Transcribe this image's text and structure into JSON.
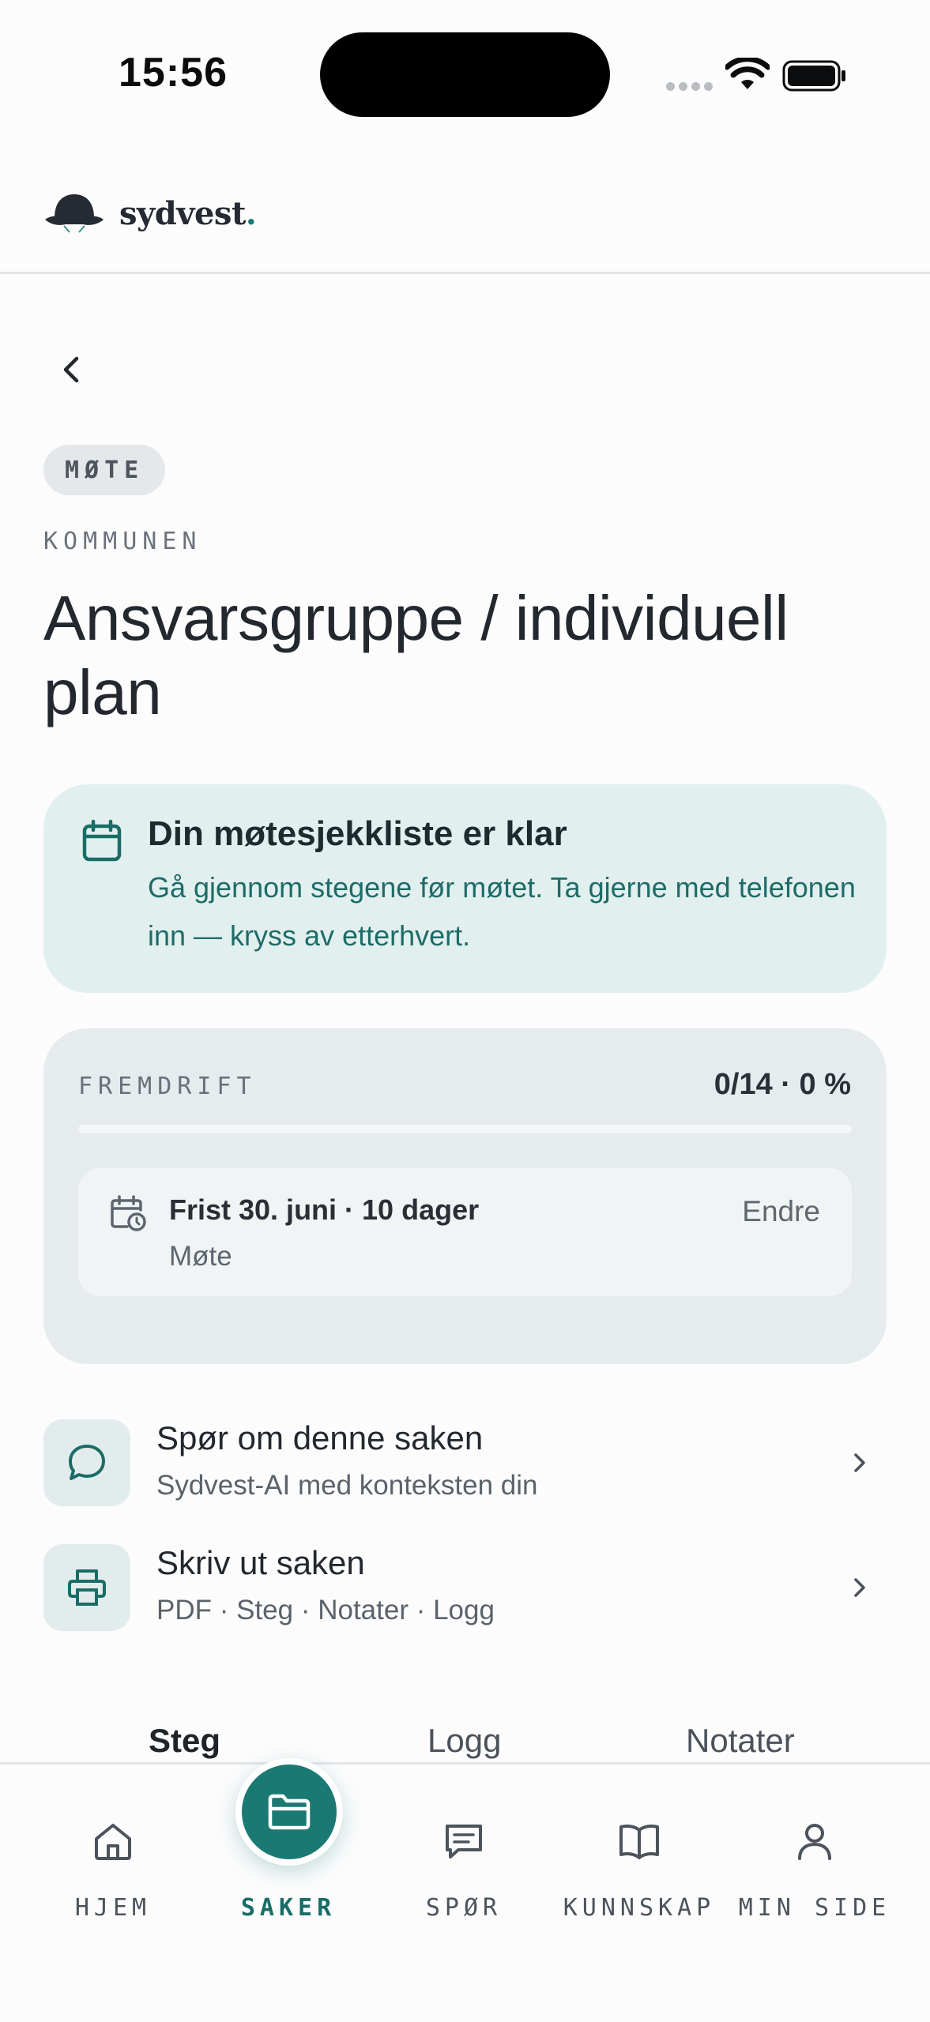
{
  "status_bar": {
    "time": "15:56"
  },
  "header": {
    "brand": "sydvest",
    "brand_dot": "."
  },
  "nav": {
    "back_icon": "chevron-left-icon"
  },
  "case": {
    "tag": "MØTE",
    "category": "KOMMUNEN",
    "title": "Ansvarsgruppe / individuell plan"
  },
  "info_card": {
    "icon": "calendar-icon",
    "title": "Din møtesjekkliste er klar",
    "body": "Gå gjennom stegene før møtet. Ta gjerne med telefonen inn — kryss av etterhvert."
  },
  "progress": {
    "label": "FREMDRIFT",
    "value_text": "0/14 · 0 %",
    "completed": 0,
    "total": 14,
    "percent": 0,
    "deadline": {
      "icon": "calendar-clock-icon",
      "title": "Frist 30. juni · 10 dager",
      "subtitle": "Møte",
      "edit_label": "Endre"
    }
  },
  "actions": [
    {
      "icon": "chat-bubble-icon",
      "title": "Spør om denne saken",
      "subtitle": "Sydvest-AI med konteksten din"
    },
    {
      "icon": "printer-icon",
      "title": "Skriv ut saken",
      "subtitle": "PDF · Steg · Notater · Logg"
    }
  ],
  "tabs": [
    {
      "label": "Steg",
      "active": true
    },
    {
      "label": "Logg",
      "active": false
    },
    {
      "label": "Notater",
      "active": false
    }
  ],
  "bottom_nav": [
    {
      "label": "HJEM",
      "icon": "home-icon",
      "active": false
    },
    {
      "label": "SAKER",
      "icon": "folder-icon",
      "active": true
    },
    {
      "label": "SPØR",
      "icon": "message-square-icon",
      "active": false
    },
    {
      "label": "KUNNSKAP",
      "icon": "book-open-icon",
      "active": false
    },
    {
      "label": "MIN SIDE",
      "icon": "user-icon",
      "active": false
    }
  ],
  "colors": {
    "accent": "#1a7a73",
    "info_bg": "#e1f0ef",
    "card_bg": "#e6ebee",
    "text_primary": "#23272e"
  }
}
